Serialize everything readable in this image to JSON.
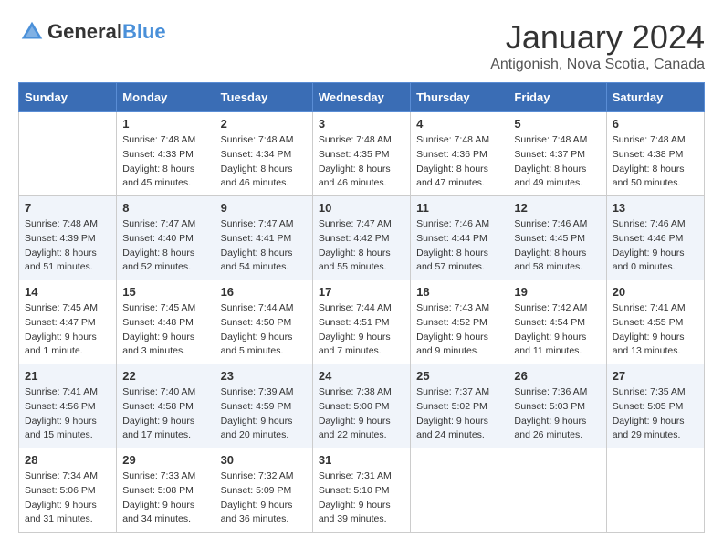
{
  "header": {
    "logo_general": "General",
    "logo_blue": "Blue",
    "month_title": "January 2024",
    "subtitle": "Antigonish, Nova Scotia, Canada"
  },
  "days_of_week": [
    "Sunday",
    "Monday",
    "Tuesday",
    "Wednesday",
    "Thursday",
    "Friday",
    "Saturday"
  ],
  "weeks": [
    [
      {
        "day": "",
        "sunrise": "",
        "sunset": "",
        "daylight": ""
      },
      {
        "day": "1",
        "sunrise": "Sunrise: 7:48 AM",
        "sunset": "Sunset: 4:33 PM",
        "daylight": "Daylight: 8 hours and 45 minutes."
      },
      {
        "day": "2",
        "sunrise": "Sunrise: 7:48 AM",
        "sunset": "Sunset: 4:34 PM",
        "daylight": "Daylight: 8 hours and 46 minutes."
      },
      {
        "day": "3",
        "sunrise": "Sunrise: 7:48 AM",
        "sunset": "Sunset: 4:35 PM",
        "daylight": "Daylight: 8 hours and 46 minutes."
      },
      {
        "day": "4",
        "sunrise": "Sunrise: 7:48 AM",
        "sunset": "Sunset: 4:36 PM",
        "daylight": "Daylight: 8 hours and 47 minutes."
      },
      {
        "day": "5",
        "sunrise": "Sunrise: 7:48 AM",
        "sunset": "Sunset: 4:37 PM",
        "daylight": "Daylight: 8 hours and 49 minutes."
      },
      {
        "day": "6",
        "sunrise": "Sunrise: 7:48 AM",
        "sunset": "Sunset: 4:38 PM",
        "daylight": "Daylight: 8 hours and 50 minutes."
      }
    ],
    [
      {
        "day": "7",
        "sunrise": "Sunrise: 7:48 AM",
        "sunset": "Sunset: 4:39 PM",
        "daylight": "Daylight: 8 hours and 51 minutes."
      },
      {
        "day": "8",
        "sunrise": "Sunrise: 7:47 AM",
        "sunset": "Sunset: 4:40 PM",
        "daylight": "Daylight: 8 hours and 52 minutes."
      },
      {
        "day": "9",
        "sunrise": "Sunrise: 7:47 AM",
        "sunset": "Sunset: 4:41 PM",
        "daylight": "Daylight: 8 hours and 54 minutes."
      },
      {
        "day": "10",
        "sunrise": "Sunrise: 7:47 AM",
        "sunset": "Sunset: 4:42 PM",
        "daylight": "Daylight: 8 hours and 55 minutes."
      },
      {
        "day": "11",
        "sunrise": "Sunrise: 7:46 AM",
        "sunset": "Sunset: 4:44 PM",
        "daylight": "Daylight: 8 hours and 57 minutes."
      },
      {
        "day": "12",
        "sunrise": "Sunrise: 7:46 AM",
        "sunset": "Sunset: 4:45 PM",
        "daylight": "Daylight: 8 hours and 58 minutes."
      },
      {
        "day": "13",
        "sunrise": "Sunrise: 7:46 AM",
        "sunset": "Sunset: 4:46 PM",
        "daylight": "Daylight: 9 hours and 0 minutes."
      }
    ],
    [
      {
        "day": "14",
        "sunrise": "Sunrise: 7:45 AM",
        "sunset": "Sunset: 4:47 PM",
        "daylight": "Daylight: 9 hours and 1 minute."
      },
      {
        "day": "15",
        "sunrise": "Sunrise: 7:45 AM",
        "sunset": "Sunset: 4:48 PM",
        "daylight": "Daylight: 9 hours and 3 minutes."
      },
      {
        "day": "16",
        "sunrise": "Sunrise: 7:44 AM",
        "sunset": "Sunset: 4:50 PM",
        "daylight": "Daylight: 9 hours and 5 minutes."
      },
      {
        "day": "17",
        "sunrise": "Sunrise: 7:44 AM",
        "sunset": "Sunset: 4:51 PM",
        "daylight": "Daylight: 9 hours and 7 minutes."
      },
      {
        "day": "18",
        "sunrise": "Sunrise: 7:43 AM",
        "sunset": "Sunset: 4:52 PM",
        "daylight": "Daylight: 9 hours and 9 minutes."
      },
      {
        "day": "19",
        "sunrise": "Sunrise: 7:42 AM",
        "sunset": "Sunset: 4:54 PM",
        "daylight": "Daylight: 9 hours and 11 minutes."
      },
      {
        "day": "20",
        "sunrise": "Sunrise: 7:41 AM",
        "sunset": "Sunset: 4:55 PM",
        "daylight": "Daylight: 9 hours and 13 minutes."
      }
    ],
    [
      {
        "day": "21",
        "sunrise": "Sunrise: 7:41 AM",
        "sunset": "Sunset: 4:56 PM",
        "daylight": "Daylight: 9 hours and 15 minutes."
      },
      {
        "day": "22",
        "sunrise": "Sunrise: 7:40 AM",
        "sunset": "Sunset: 4:58 PM",
        "daylight": "Daylight: 9 hours and 17 minutes."
      },
      {
        "day": "23",
        "sunrise": "Sunrise: 7:39 AM",
        "sunset": "Sunset: 4:59 PM",
        "daylight": "Daylight: 9 hours and 20 minutes."
      },
      {
        "day": "24",
        "sunrise": "Sunrise: 7:38 AM",
        "sunset": "Sunset: 5:00 PM",
        "daylight": "Daylight: 9 hours and 22 minutes."
      },
      {
        "day": "25",
        "sunrise": "Sunrise: 7:37 AM",
        "sunset": "Sunset: 5:02 PM",
        "daylight": "Daylight: 9 hours and 24 minutes."
      },
      {
        "day": "26",
        "sunrise": "Sunrise: 7:36 AM",
        "sunset": "Sunset: 5:03 PM",
        "daylight": "Daylight: 9 hours and 26 minutes."
      },
      {
        "day": "27",
        "sunrise": "Sunrise: 7:35 AM",
        "sunset": "Sunset: 5:05 PM",
        "daylight": "Daylight: 9 hours and 29 minutes."
      }
    ],
    [
      {
        "day": "28",
        "sunrise": "Sunrise: 7:34 AM",
        "sunset": "Sunset: 5:06 PM",
        "daylight": "Daylight: 9 hours and 31 minutes."
      },
      {
        "day": "29",
        "sunrise": "Sunrise: 7:33 AM",
        "sunset": "Sunset: 5:08 PM",
        "daylight": "Daylight: 9 hours and 34 minutes."
      },
      {
        "day": "30",
        "sunrise": "Sunrise: 7:32 AM",
        "sunset": "Sunset: 5:09 PM",
        "daylight": "Daylight: 9 hours and 36 minutes."
      },
      {
        "day": "31",
        "sunrise": "Sunrise: 7:31 AM",
        "sunset": "Sunset: 5:10 PM",
        "daylight": "Daylight: 9 hours and 39 minutes."
      },
      {
        "day": "",
        "sunrise": "",
        "sunset": "",
        "daylight": ""
      },
      {
        "day": "",
        "sunrise": "",
        "sunset": "",
        "daylight": ""
      },
      {
        "day": "",
        "sunrise": "",
        "sunset": "",
        "daylight": ""
      }
    ]
  ]
}
